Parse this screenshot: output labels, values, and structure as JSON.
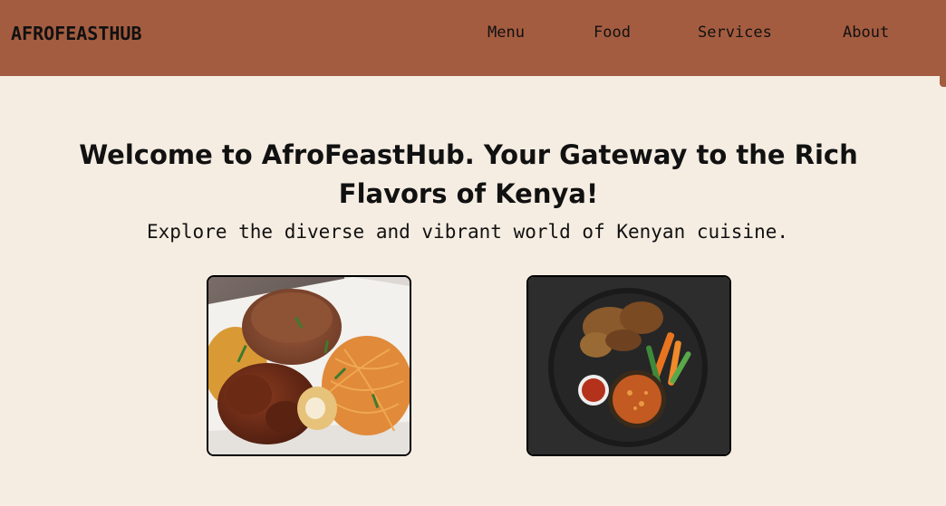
{
  "brand": {
    "name": "AFROFEASTHUB"
  },
  "nav": {
    "items": [
      "Menu",
      "Food",
      "Services",
      "About"
    ]
  },
  "hero": {
    "title": "Welcome to AfroFeastHub. Your Gateway to the Rich Flavors of Kenya!",
    "subtitle": "Explore the diverse and vibrant world of Kenyan cuisine."
  },
  "dishes": [
    {
      "icon": "rice-and-spaghetti-plate-image"
    },
    {
      "icon": "roast-chicken-platter-image"
    }
  ],
  "colors": {
    "header": "#a45c40",
    "background": "#f5ede2",
    "text": "#111111"
  }
}
